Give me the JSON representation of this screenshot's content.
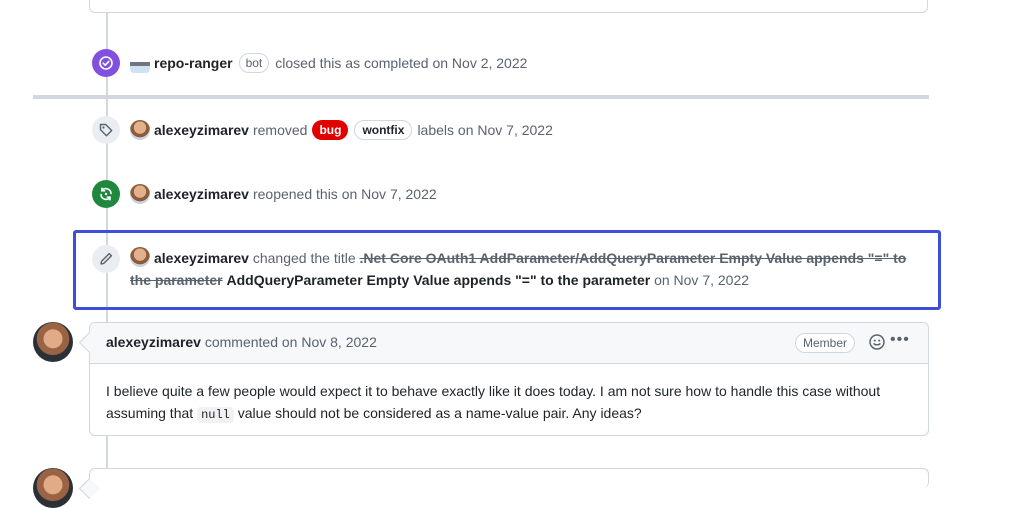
{
  "events": {
    "closed": {
      "user": "repo-ranger",
      "badge": "bot",
      "text": "closed this as completed on Nov 2, 2022"
    },
    "labels_removed": {
      "user": "alexeyzimarev",
      "verb": "removed",
      "label1": "bug",
      "label2": "wontfix",
      "suffix": "labels on Nov 7, 2022"
    },
    "reopened": {
      "user": "alexeyzimarev",
      "text": "reopened this on Nov 7, 2022"
    },
    "title_change": {
      "user": "alexeyzimarev",
      "verb": "changed the title",
      "old_title": ".Net Core OAuth1 AddParameter/AddQueryParameter Empty Value appends \"=\" to the parameter",
      "new_title": "AddQueryParameter Empty Value appends \"=\" to the parameter",
      "date": "on Nov 7, 2022"
    }
  },
  "comment": {
    "author": "alexeyzimarev",
    "meta": "commented on Nov 8, 2022",
    "role": "Member",
    "body_part1": "I believe quite a few people would expect it to behave exactly like it does today. I am not sure how to handle this case without assuming that",
    "code": "null",
    "body_part2": "value should not be considered as a name-value pair. Any ideas?"
  },
  "colors": {
    "closed_badge": "#8250df",
    "reopened_badge": "#1f883d",
    "bug_label": "#e00000",
    "highlight_border": "#3d4fd9"
  },
  "icons": {
    "closed": "check-circle-icon",
    "label": "tag-icon",
    "reopened": "sync-icon",
    "rename": "pencil-icon"
  }
}
